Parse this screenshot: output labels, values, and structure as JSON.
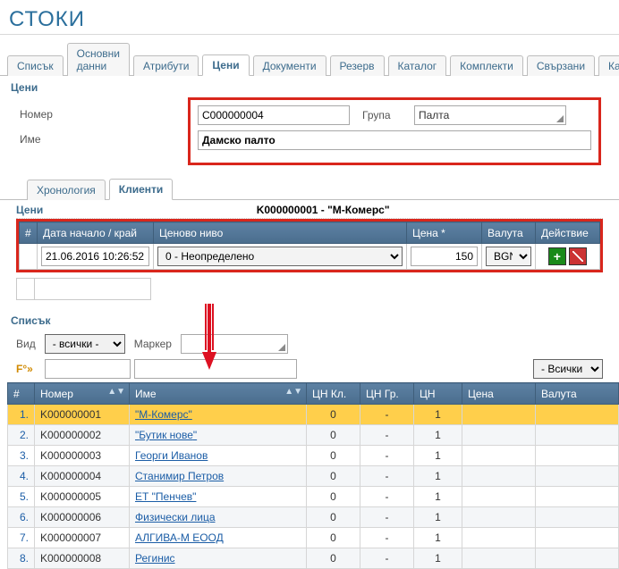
{
  "page_title": "СТОКИ",
  "main_tabs": [
    "Списък",
    "Основни данни",
    "Атрибути",
    "Цени",
    "Документи",
    "Резерв",
    "Каталог",
    "Комплекти",
    "Свързани",
    "Картон"
  ],
  "main_active": 3,
  "section_prices": "Цени",
  "form": {
    "label_number": "Номер",
    "label_name": "Име",
    "label_group": "Група",
    "number": "C000000004",
    "group": "Палта",
    "name": "Дамско палто"
  },
  "sub_tabs": [
    "Хронология",
    "Клиенти"
  ],
  "sub_active": 1,
  "client_header": {
    "code": "K000000001",
    "name": "М-Комерс"
  },
  "grid": {
    "cols": {
      "idx": "#",
      "date": "Дата начало / край",
      "level": "Ценово ниво",
      "price": "Цена *",
      "currency": "Валута",
      "action": "Действие"
    },
    "row": {
      "date": "21.06.2016 10:26:52",
      "level": "0 - Неопределено",
      "price": "150",
      "currency": "BGN"
    }
  },
  "section_list": "Списък",
  "filters": {
    "view_label": "Вид",
    "view_value": "- всички -",
    "marker_label": "Маркер",
    "f_label": "F°»",
    "all_value": "- Всички -"
  },
  "list": {
    "cols": {
      "idx": "#",
      "num": "Номер",
      "name": "Име",
      "cnkl": "ЦН Кл.",
      "cngr": "ЦН Гр.",
      "cn": "ЦН",
      "price": "Цена",
      "cur": "Валута"
    },
    "rows": [
      {
        "i": "1.",
        "num": "K000000001",
        "name": "М-Комерс",
        "quoted": true,
        "cnkl": "0",
        "cngr": "-",
        "cn": "1",
        "sel": true
      },
      {
        "i": "2.",
        "num": "K000000002",
        "name": "Бутик нове",
        "quoted": true,
        "cnkl": "0",
        "cngr": "-",
        "cn": "1"
      },
      {
        "i": "3.",
        "num": "K000000003",
        "name": "Георги Иванов",
        "quoted": false,
        "cnkl": "0",
        "cngr": "-",
        "cn": "1"
      },
      {
        "i": "4.",
        "num": "K000000004",
        "name": "Станимир Петров",
        "quoted": false,
        "cnkl": "0",
        "cngr": "-",
        "cn": "1"
      },
      {
        "i": "5.",
        "num": "K000000005",
        "name": "ЕТ \"Пенчев\"",
        "quoted": false,
        "cnkl": "0",
        "cngr": "-",
        "cn": "1"
      },
      {
        "i": "6.",
        "num": "K000000006",
        "name": "Физически лица",
        "quoted": false,
        "cnkl": "0",
        "cngr": "-",
        "cn": "1"
      },
      {
        "i": "7.",
        "num": "K000000007",
        "name": "АЛГИВА-М ЕООД",
        "quoted": false,
        "cnkl": "0",
        "cngr": "-",
        "cn": "1"
      },
      {
        "i": "8.",
        "num": "K000000008",
        "name": "Регинис",
        "quoted": false,
        "cnkl": "0",
        "cngr": "-",
        "cn": "1"
      }
    ]
  }
}
